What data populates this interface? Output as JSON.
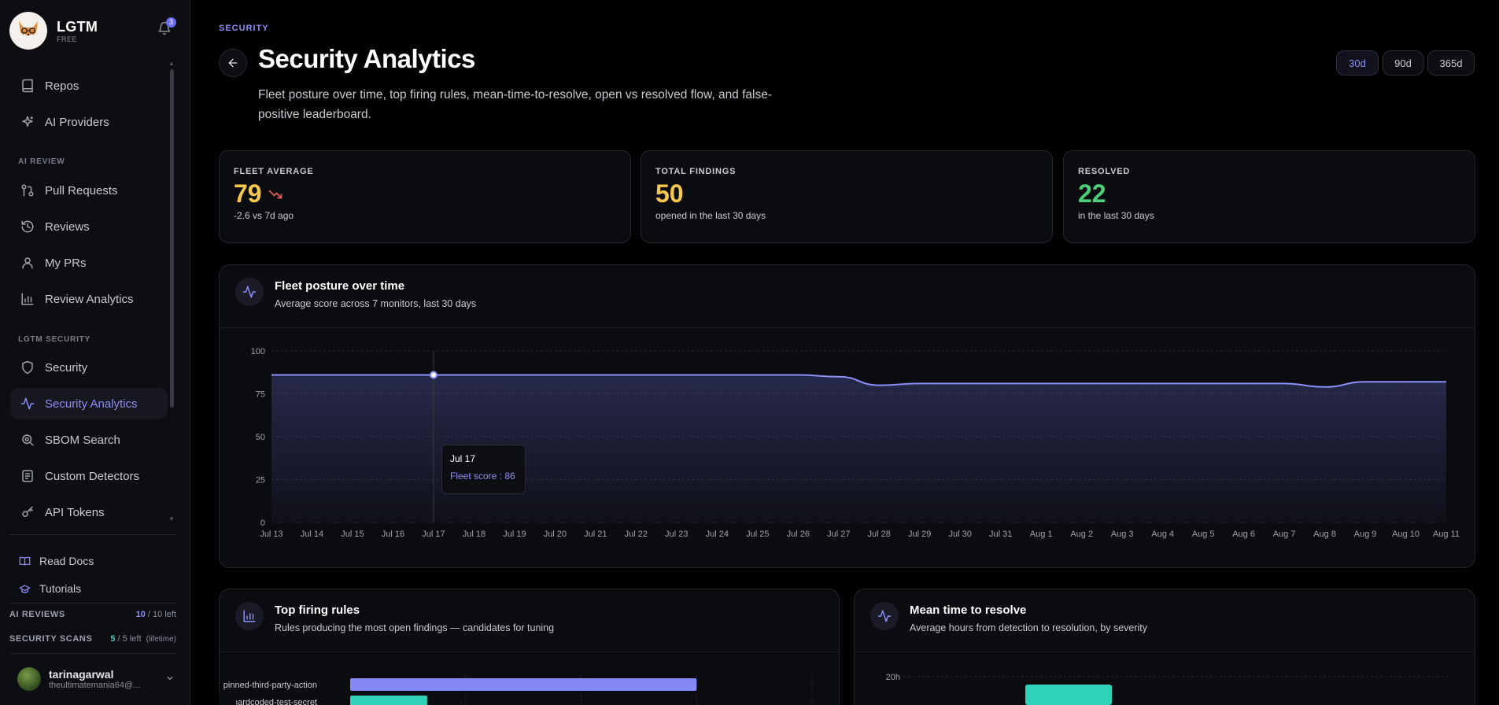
{
  "sidebar": {
    "brand": {
      "name": "LGTM",
      "plan": "FREE"
    },
    "notifications_count": "3",
    "items_top": [
      {
        "label": "Repos",
        "icon": "repo-icon"
      },
      {
        "label": "AI Providers",
        "icon": "sparkles-icon"
      }
    ],
    "section_ai_review": "AI REVIEW",
    "items_ai": [
      {
        "label": "Pull Requests",
        "icon": "pull-request-icon"
      },
      {
        "label": "Reviews",
        "icon": "history-icon"
      },
      {
        "label": "My PRs",
        "icon": "user-icon"
      },
      {
        "label": "Review Analytics",
        "icon": "bar-chart-icon"
      }
    ],
    "section_security": "LGTM SECURITY",
    "items_security": [
      {
        "label": "Security",
        "icon": "shield-icon"
      },
      {
        "label": "Security Analytics",
        "icon": "activity-icon",
        "active": true
      },
      {
        "label": "SBOM Search",
        "icon": "search-icon"
      },
      {
        "label": "Custom Detectors",
        "icon": "file-icon"
      },
      {
        "label": "API Tokens",
        "icon": "key-icon"
      }
    ],
    "footer_links": [
      {
        "label": "Read Docs",
        "icon": "book-icon"
      },
      {
        "label": "Tutorials",
        "icon": "graduation-cap-icon"
      }
    ],
    "quotas": [
      {
        "label": "AI REVIEWS",
        "used": "10",
        "rest": " / 10 left",
        "extra": "",
        "color": "#8b8ff7"
      },
      {
        "label": "SECURITY SCANS",
        "used": "5",
        "rest": " / 5 left",
        "extra": "(lifetime)",
        "color": "#3ecfb8"
      }
    ],
    "user": {
      "name": "tarinagarwal",
      "email": "theultimatemania64@..."
    }
  },
  "header": {
    "breadcrumb": "SECURITY",
    "title": "Security Analytics",
    "description": "Fleet posture over time, top firing rules, mean-time-to-resolve, open vs resolved flow, and false-positive leaderboard.",
    "ranges": [
      "30d",
      "90d",
      "365d"
    ],
    "active_range": "30d"
  },
  "stats": [
    {
      "label": "FLEET AVERAGE",
      "value": "79",
      "sub": "-2.6 vs 7d ago",
      "color": "#f5c84b",
      "trend": "down"
    },
    {
      "label": "TOTAL FINDINGS",
      "value": "50",
      "sub": "opened in the last 30 days",
      "color": "#f5c84b"
    },
    {
      "label": "RESOLVED",
      "value": "22",
      "sub": "in the last 30 days",
      "color": "#4ad07a"
    }
  ],
  "posture_card": {
    "title": "Fleet posture over time",
    "subtitle": "Average score across 7 monitors, last 30 days",
    "tooltip": {
      "date": "Jul 17",
      "label": "Fleet score : 86"
    }
  },
  "rules_card": {
    "title": "Top firing rules",
    "subtitle": "Rules producing the most open findings — candidates for tuning"
  },
  "mttr_card": {
    "title": "Mean time to resolve",
    "subtitle": "Average hours from detection to resolution, by severity"
  },
  "chart_data": [
    {
      "type": "area",
      "title": "Fleet posture over time",
      "x": [
        "Jul 13",
        "Jul 14",
        "Jul 15",
        "Jul 16",
        "Jul 17",
        "Jul 18",
        "Jul 19",
        "Jul 20",
        "Jul 21",
        "Jul 22",
        "Jul 23",
        "Jul 24",
        "Jul 25",
        "Jul 26",
        "Jul 27",
        "Jul 28",
        "Jul 29",
        "Jul 30",
        "Jul 31",
        "Aug 1",
        "Aug 2",
        "Aug 3",
        "Aug 4",
        "Aug 5",
        "Aug 6",
        "Aug 7",
        "Aug 8",
        "Aug 9",
        "Aug 10",
        "Aug 11"
      ],
      "series": [
        {
          "name": "Fleet score",
          "values": [
            86,
            86,
            86,
            86,
            86,
            86,
            86,
            86,
            86,
            86,
            86,
            86,
            86,
            86,
            85,
            80,
            81,
            81,
            81,
            81,
            81,
            81,
            81,
            81,
            81,
            81,
            79,
            82,
            82,
            82
          ]
        }
      ],
      "yticks": [
        0,
        25,
        50,
        75,
        100
      ],
      "ylim": [
        0,
        100
      ],
      "grid": true,
      "color": "#8b8ff7"
    },
    {
      "type": "bar",
      "title": "Top firing rules",
      "orientation": "horizontal",
      "categories": [
        "pinned-third-party-action",
        "no-hardcoded-test-secret"
      ],
      "values": [
        9,
        2
      ],
      "colors": [
        "#8589f5",
        "#2fd1b8"
      ],
      "xlim": [
        0,
        12
      ]
    },
    {
      "type": "bar",
      "title": "Mean time to resolve",
      "yticks_visible": [
        "20h"
      ],
      "ylim": [
        0,
        20
      ],
      "values": [
        19
      ],
      "color": "#2fd1b8"
    }
  ]
}
